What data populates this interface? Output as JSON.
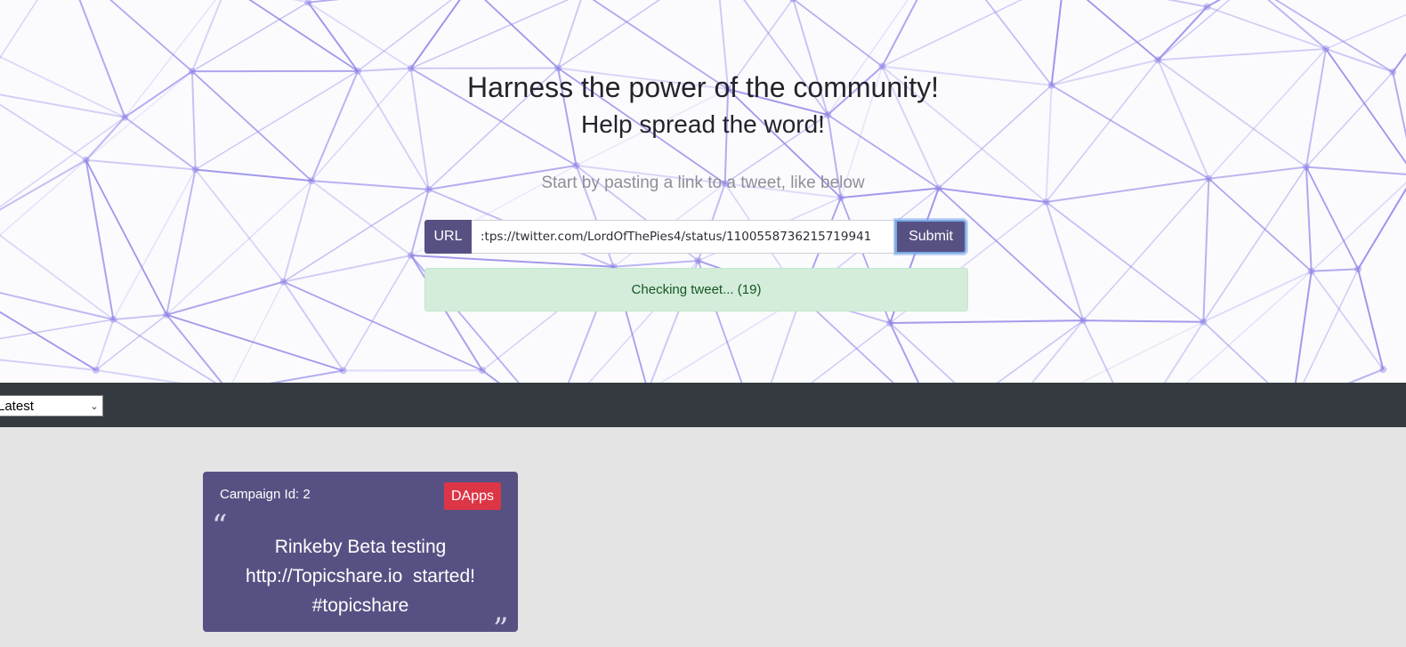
{
  "hero": {
    "title": "Harness the power of the community!",
    "subtitle": "Help spread the word!",
    "hint": "Start by pasting a link to a tweet, like below"
  },
  "url_form": {
    "label": "URL",
    "value": ":tps://twitter.com/LordOfThePies4/status/1100558736215719941",
    "submit_label": "Submit"
  },
  "status": {
    "message": "Checking tweet... (19)"
  },
  "toolbar": {
    "sort_value": "Latest"
  },
  "campaign_card": {
    "id_label": "Campaign Id: 2",
    "badge": "DApps",
    "text_line1": "Rinkeby Beta testing",
    "text_line2": "http://Topicshare.io  started!",
    "text_line3": "#topicshare"
  },
  "colors": {
    "primary": "#575183",
    "navbar": "#343a40",
    "badge": "#dc3545",
    "alert_bg": "#d4edda",
    "alert_text": "#155724",
    "mesh": "#8c82e6"
  },
  "icons": {
    "select_chevron": "chevron-down-icon",
    "quote_open": "open-quote-icon",
    "quote_close": "close-quote-icon"
  }
}
